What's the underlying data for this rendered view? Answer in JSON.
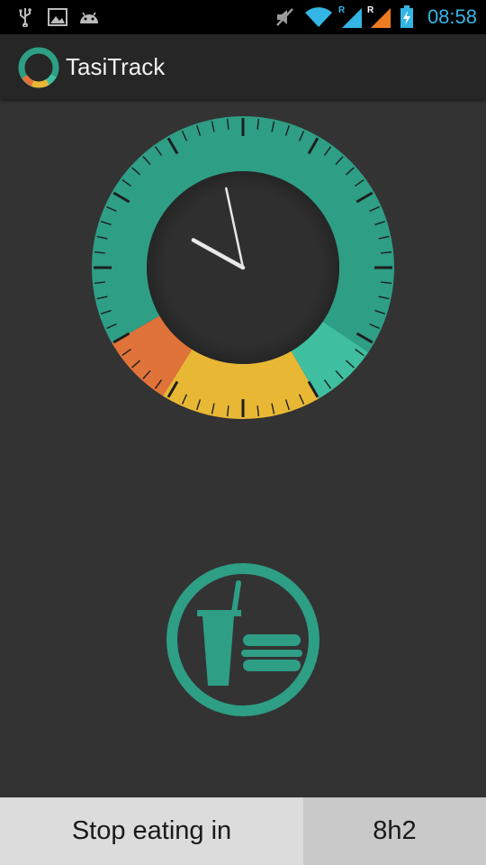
{
  "status_bar": {
    "time": "08:58",
    "icons": [
      "usb-icon",
      "image-icon",
      "android-icon",
      "mute-icon",
      "wifi-icon",
      "signal-icon",
      "signal-icon",
      "battery-charging-icon"
    ],
    "roaming_mark": "R"
  },
  "app": {
    "title": "TasiTrack",
    "logo_icon": "ring-logo-icon"
  },
  "clock": {
    "hour": 9,
    "minute": 58,
    "segments": [
      {
        "name": "fasting",
        "color": "#2e9e85"
      },
      {
        "name": "warning-end",
        "color": "#3fbf9f"
      },
      {
        "name": "eating",
        "color": "#e8b835"
      },
      {
        "name": "warning-start",
        "color": "#e0733a"
      }
    ]
  },
  "action": {
    "icon": "food-drink-icon",
    "color": "#2e9e85"
  },
  "bottom_bar": {
    "label": "Stop eating in",
    "value": "8h2"
  }
}
